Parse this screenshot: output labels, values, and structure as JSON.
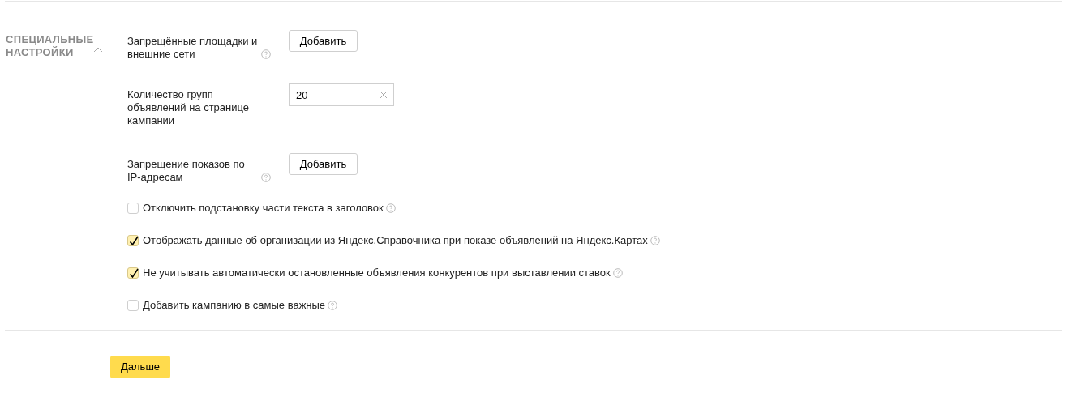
{
  "section": {
    "title": "СПЕЦИАЛЬНЫЕ НАСТРОЙКИ",
    "expanded": true
  },
  "fields": [
    {
      "label": "Запрещённые площадки и внешние сети",
      "help": true,
      "kind": "button",
      "control": "Добавить"
    },
    {
      "label": "Количество групп объявлений на странице кампании",
      "help": false,
      "kind": "input",
      "value": "20"
    },
    {
      "label": "Запрещение показов по IP-адресам",
      "help": true,
      "kind": "button",
      "control": "Добавить"
    }
  ],
  "checkboxes": [
    {
      "label": "Отключить подстановку части текста в заголовок",
      "checked": false
    },
    {
      "label": "Отображать данные об организации из Яндекс.Справочника при показе объявлений на Яндекс.Картах",
      "checked": true
    },
    {
      "label": "Не учитывать автоматически остановленные объявления конкурентов при выставлении ставок",
      "checked": true
    },
    {
      "label": "Добавить кампанию в самые важные",
      "checked": false
    }
  ],
  "next_button": "Дальше"
}
